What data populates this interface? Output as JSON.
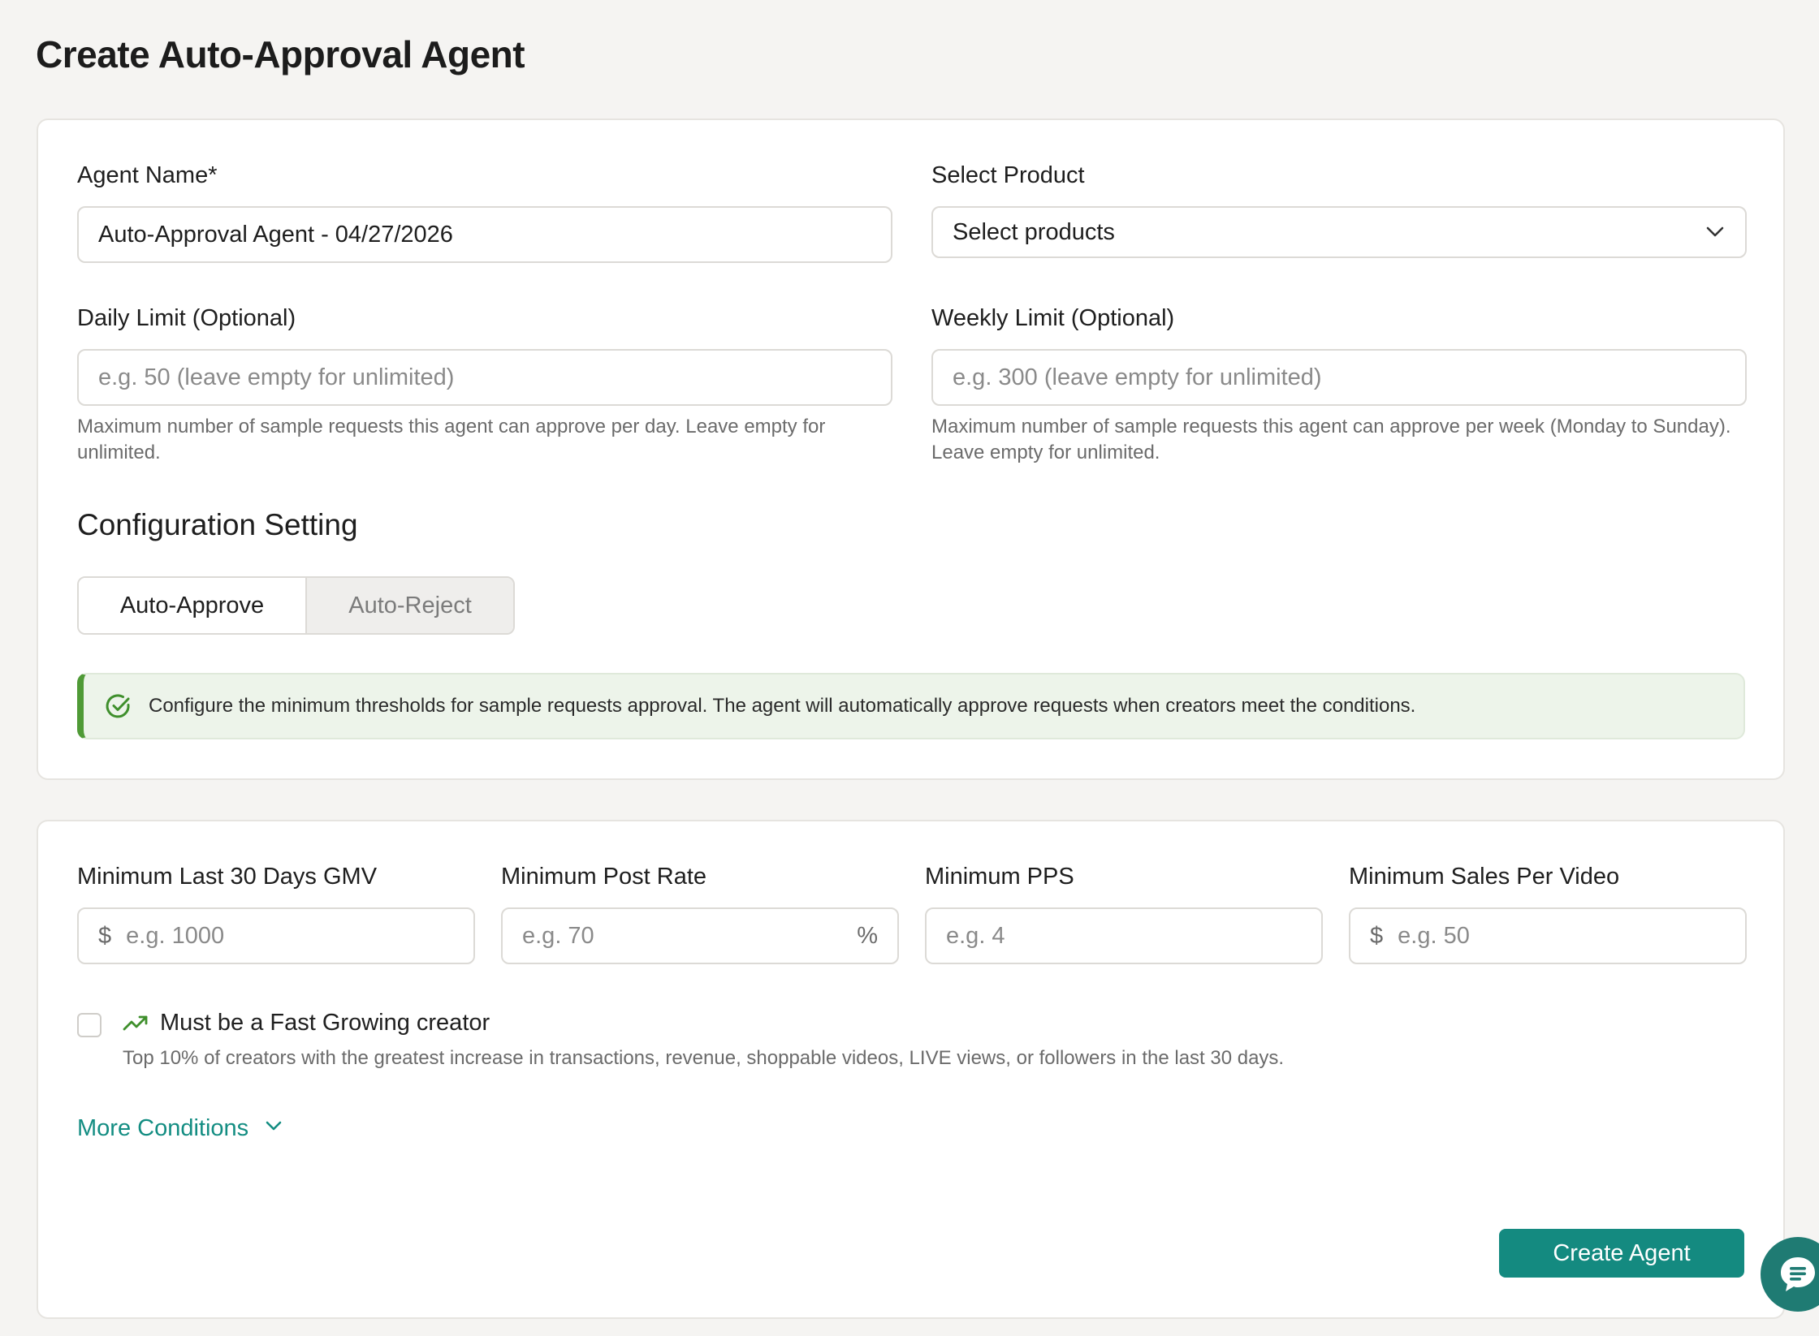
{
  "page": {
    "title": "Create Auto-Approval Agent"
  },
  "form": {
    "agent_name": {
      "label": "Agent Name*",
      "value": "Auto-Approval Agent - 04/27/2026"
    },
    "product": {
      "label": "Select Product",
      "selected": "Select products"
    },
    "daily_limit": {
      "label": "Daily Limit (Optional)",
      "placeholder": "e.g. 50 (leave empty for unlimited)",
      "help": "Maximum number of sample requests this agent can approve per day. Leave empty for unlimited."
    },
    "weekly_limit": {
      "label": "Weekly Limit (Optional)",
      "placeholder": "e.g. 300 (leave empty for unlimited)",
      "help": "Maximum number of sample requests this agent can approve per week (Monday to Sunday). Leave empty for unlimited."
    }
  },
  "config": {
    "title": "Configuration Setting",
    "modes": [
      {
        "label": "Auto-Approve",
        "active": true
      },
      {
        "label": "Auto-Reject",
        "active": false
      }
    ],
    "info": "Configure the minimum thresholds for sample requests approval. The agent will automatically approve requests when creators meet the conditions."
  },
  "thresholds": {
    "gmv": {
      "label": "Minimum Last 30 Days GMV",
      "prefix": "$",
      "placeholder": "e.g. 1000"
    },
    "post_rate": {
      "label": "Minimum Post Rate",
      "placeholder": "e.g. 70",
      "suffix": "%"
    },
    "pps": {
      "label": "Minimum PPS",
      "placeholder": "e.g. 4"
    },
    "sales_per_video": {
      "label": "Minimum Sales Per Video",
      "prefix": "$",
      "placeholder": "e.g. 50"
    }
  },
  "fast_growing": {
    "checked": false,
    "label": "Must be a Fast Growing creator",
    "description": "Top 10% of creators with the greatest increase in transactions, revenue, shoppable videos, LIVE views, or followers in the last 30 days."
  },
  "more_conditions": {
    "label": "More Conditions"
  },
  "actions": {
    "create_label": "Create Agent"
  },
  "colors": {
    "accent": "#148a80",
    "link": "#138d82",
    "success": "#4f9a36",
    "success_bg": "#edf4ea"
  }
}
